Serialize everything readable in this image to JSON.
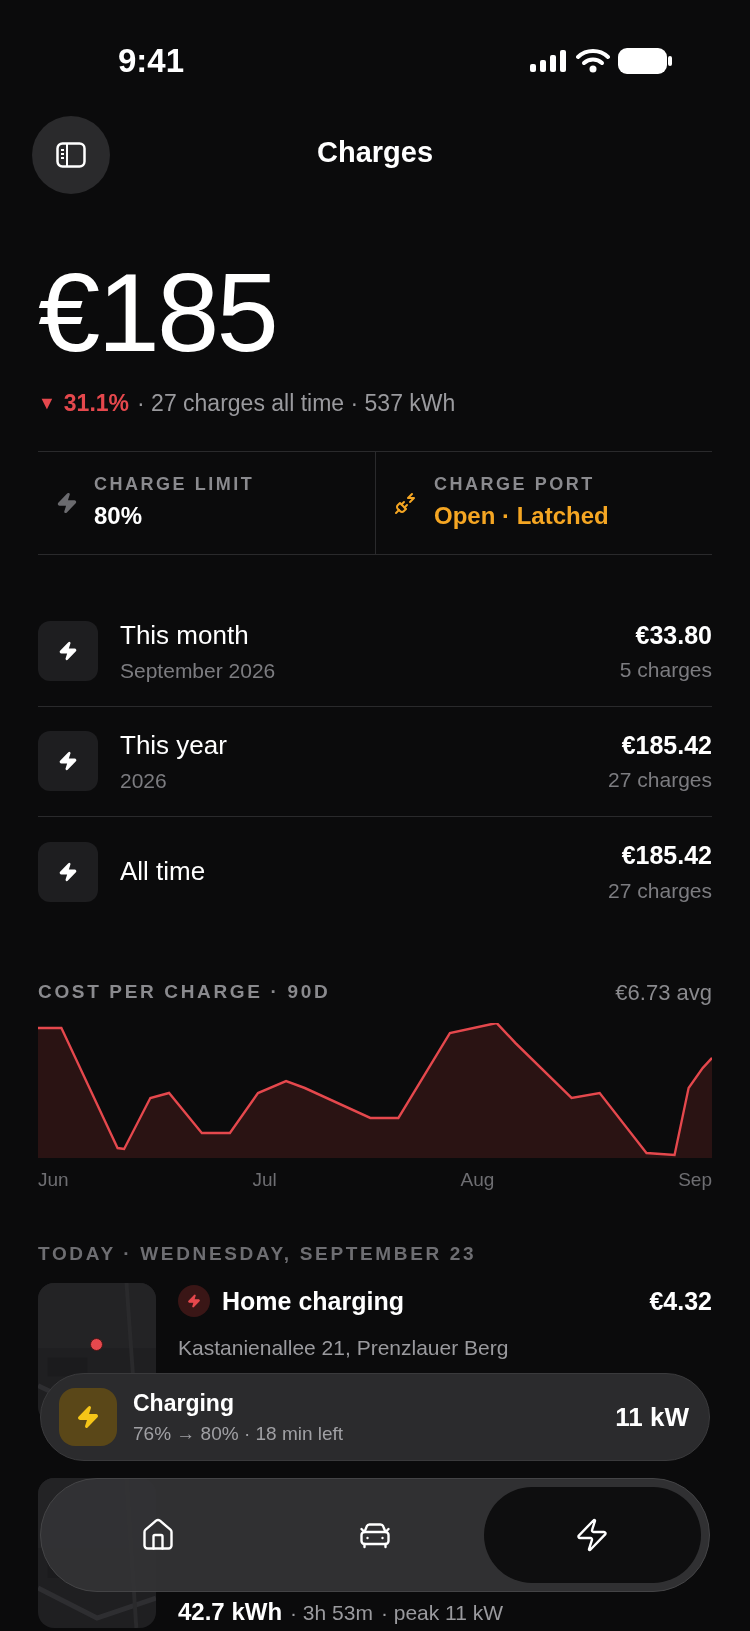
{
  "status_bar": {
    "time": "9:41"
  },
  "header": {
    "title": "Charges"
  },
  "summary": {
    "total": "€185",
    "trend_mark": "▼",
    "change": "31.1%",
    "details": "· 27 charges all time · 537 kWh"
  },
  "stats": [
    {
      "kind": "limit",
      "label": "CHARGE LIMIT",
      "value": "80%"
    },
    {
      "kind": "port",
      "label": "CHARGE PORT",
      "value": "Open · Latched"
    }
  ],
  "periods": [
    {
      "title": "This month",
      "subtitle": "September 2026",
      "amount": "€33.80",
      "count": "5 charges"
    },
    {
      "title": "This year",
      "subtitle": "2026",
      "amount": "€185.42",
      "count": "27 charges"
    },
    {
      "title": "All time",
      "amount": "€185.42",
      "count": "27 charges"
    }
  ],
  "chart": {
    "title": "COST PER CHARGE · 90D",
    "average": "€6.73 avg",
    "x_labels": [
      "Jun",
      "Jul",
      "Aug",
      "Sep"
    ]
  },
  "today": {
    "heading": "TODAY · WEDNESDAY, SEPTEMBER 23",
    "title": "Home charging",
    "amount": "€4.32",
    "address": "Kastanienallee 21, Prenzlauer Berg"
  },
  "earlier": {
    "energy": "42.7 kWh",
    "duration": "· 3h 53m",
    "peak": "· peak 11 kW"
  },
  "charging": {
    "title": "Charging",
    "detail": "76% → 80% · 18 min left",
    "power": "11 kW"
  },
  "tabs": [
    {
      "kind": "home",
      "selected": false
    },
    {
      "kind": "car",
      "selected": false
    },
    {
      "kind": "charge",
      "selected": true
    }
  ]
}
